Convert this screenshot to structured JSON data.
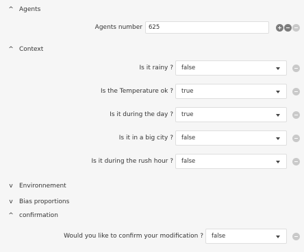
{
  "sections": {
    "agents": {
      "title": "Agents",
      "expanded": true
    },
    "context": {
      "title": "Context",
      "expanded": true
    },
    "environnement": {
      "title": "Environnement",
      "expanded": false
    },
    "bias": {
      "title": "Bias proportions",
      "expanded": false
    },
    "confirmation": {
      "title": "confirmation",
      "expanded": true
    }
  },
  "icons": {
    "expanded": "chevron-up-icon",
    "collapsed": "chevron-down-icon",
    "add": "plus-circle-icon",
    "remove": "minus-circle-icon"
  },
  "chev": {
    "up": "^",
    "down": "v"
  },
  "agents_number": {
    "label": "Agents number",
    "value": "625"
  },
  "context_params": [
    {
      "label": "Is it rainy ?",
      "value": "false"
    },
    {
      "label": "Is the Temperature ok ?",
      "value": "true"
    },
    {
      "label": "Is it during the day ?",
      "value": "true"
    },
    {
      "label": "Is it in a big city ?",
      "value": "false"
    },
    {
      "label": "Is it during the rush hour ?",
      "value": "false"
    }
  ],
  "confirm": {
    "label": "Would you like to confirm your modification ?",
    "value": "false"
  },
  "colors": {
    "background": "#f6f6f6",
    "field": "#ffffff",
    "border": "#dedede",
    "icon_dark": "#7c7c7c",
    "icon_light": "#c9c9c9"
  }
}
